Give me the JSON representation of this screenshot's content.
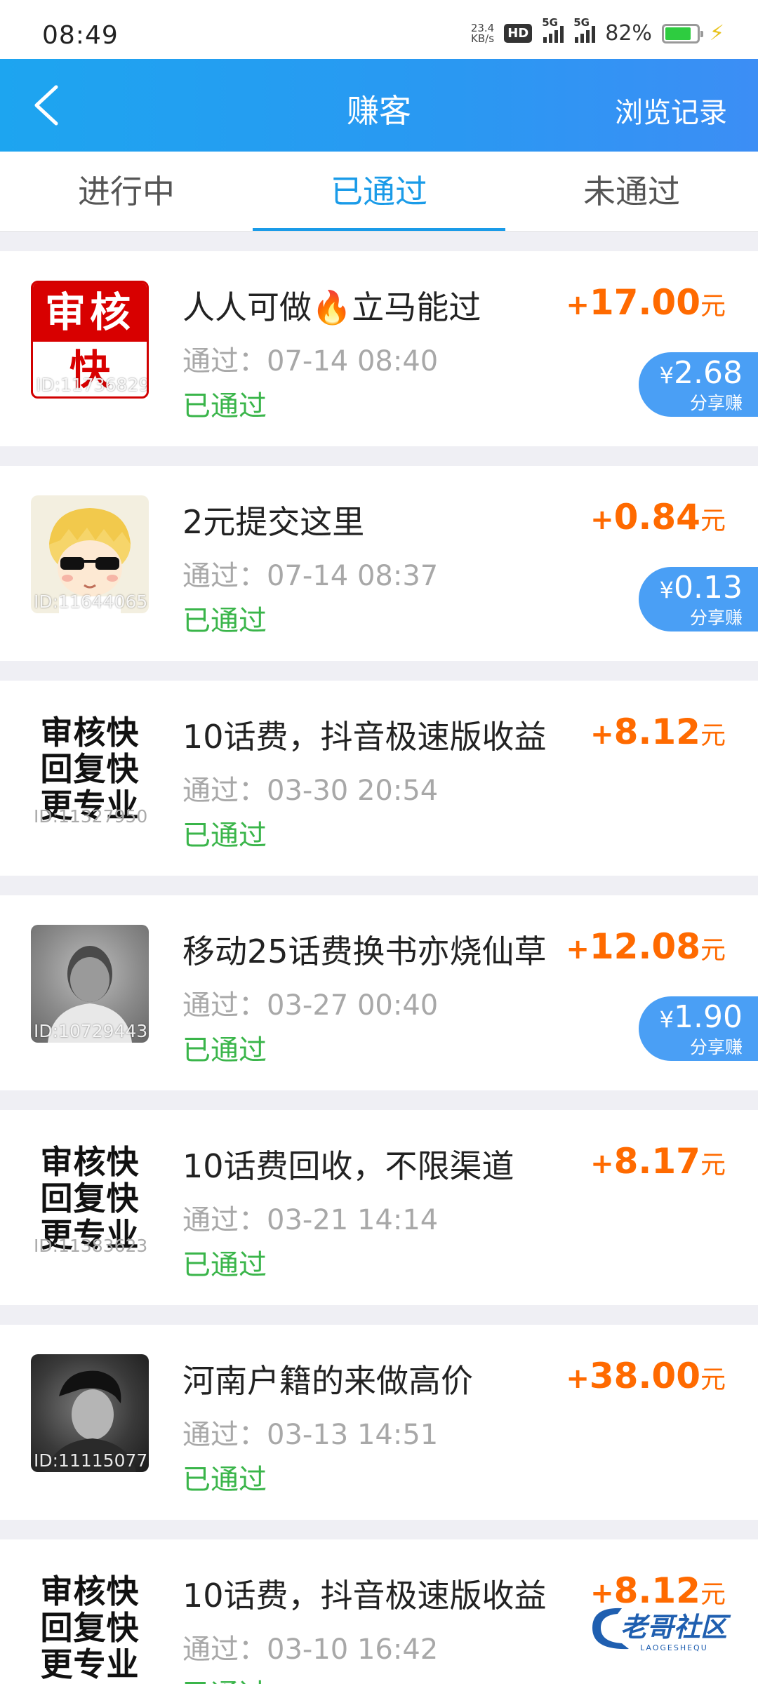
{
  "status_bar": {
    "time": "08:49",
    "net_speed": "23.4",
    "net_unit": "KB/s",
    "hd": "HD",
    "sim1": "5G",
    "sim2": "5G",
    "battery": "82%"
  },
  "nav": {
    "title": "赚客",
    "right": "浏览记录"
  },
  "tabs": [
    {
      "label": "进行中"
    },
    {
      "label": "已通过"
    },
    {
      "label": "未通过"
    }
  ],
  "list": [
    {
      "title": "人人可做🔥立马能过",
      "time": "通过：07-14 08:40",
      "status": "已通过",
      "plus": "+",
      "amount": "17.00",
      "unit": "元",
      "share": "2.68",
      "share_label": "分享赚",
      "thumb_id": "ID:11736829",
      "thumb_line1": "审核",
      "thumb_line2": "快"
    },
    {
      "title": "2元提交这里",
      "time": "通过：07-14 08:37",
      "status": "已通过",
      "plus": "+",
      "amount": "0.84",
      "unit": "元",
      "share": "0.13",
      "share_label": "分享赚",
      "thumb_id": "ID:11644065"
    },
    {
      "title": "10话费，抖音极速版收益",
      "time": "通过：03-30 20:54",
      "status": "已通过",
      "plus": "+",
      "amount": "8.12",
      "unit": "元",
      "thumb_id": "ID:11327950",
      "thumb_lines": [
        "审核快",
        "回复快",
        "更专业"
      ]
    },
    {
      "title": "移动25话费换书亦烧仙草",
      "time": "通过：03-27 00:40",
      "status": "已通过",
      "plus": "+",
      "amount": "12.08",
      "unit": "元",
      "share": "1.90",
      "share_label": "分享赚",
      "thumb_id": "ID:10729443"
    },
    {
      "title": "10话费回收，不限渠道",
      "time": "通过：03-21 14:14",
      "status": "已通过",
      "plus": "+",
      "amount": "8.17",
      "unit": "元",
      "thumb_id": "ID:11383623",
      "thumb_lines": [
        "审核快",
        "回复快",
        "更专业"
      ]
    },
    {
      "title": "河南户籍的来做高价",
      "time": "通过：03-13 14:51",
      "status": "已通过",
      "plus": "+",
      "amount": "38.00",
      "unit": "元",
      "thumb_id": "ID:11115077"
    },
    {
      "title": "10话费，抖音极速版收益",
      "time": "通过：03-10 16:42",
      "status": "已通过",
      "plus": "+",
      "amount": "8.12",
      "unit": "元",
      "thumb_lines": [
        "审核快",
        "回复快",
        "更专业"
      ]
    }
  ],
  "watermark": {
    "text": "老哥社区",
    "sub": "LAOGESHEQU"
  },
  "colors": {
    "accent": "#1a9be8",
    "amount": "#ff6a00",
    "passed": "#3ab54a",
    "share_bg": "#4a9ff5"
  }
}
